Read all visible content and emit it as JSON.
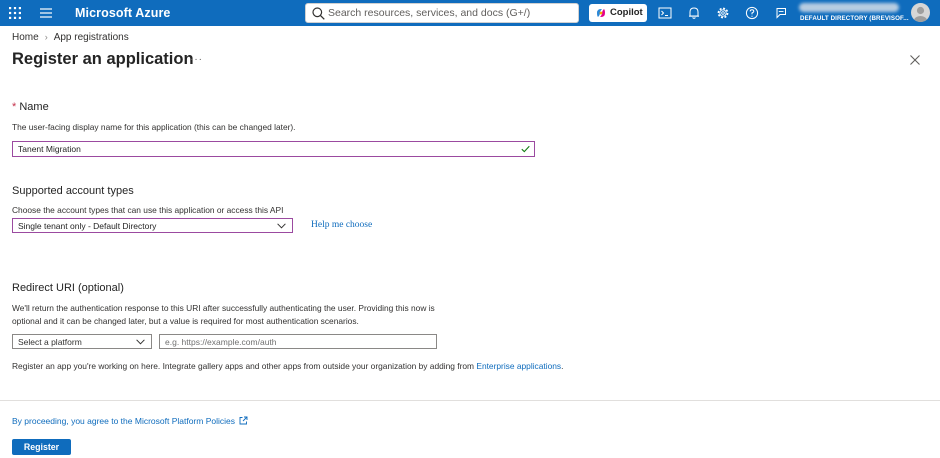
{
  "topbar": {
    "brand": "Microsoft Azure",
    "search_placeholder": "Search resources, services, and docs (G+/)",
    "copilot_label": "Copilot",
    "directory": "DEFAULT DIRECTORY (BREVISOF...",
    "icons": [
      "waffle-icon",
      "hamburger-icon",
      "cloud-shell-icon",
      "notifications-icon",
      "settings-icon",
      "help-icon",
      "feedback-icon"
    ]
  },
  "breadcrumb": {
    "home": "Home",
    "current": "App registrations"
  },
  "page": {
    "title": "Register an application",
    "more": "···"
  },
  "name_section": {
    "required_mark": "*",
    "label": "Name",
    "description": "The user-facing display name for this application (this can be changed later).",
    "value": "Tanent Migration"
  },
  "account_types": {
    "label": "Supported account types",
    "description": "Choose the account types that can use this application or access this API",
    "selected": "Single tenant only - Default Directory",
    "help_link": "Help me choose"
  },
  "redirect": {
    "label": "Redirect URI (optional)",
    "description_line1": "We'll return the authentication response to this URI after successfully authenticating the user. Providing this now is",
    "description_line2": "optional and it can be changed later, but a value is required for most authentication scenarios.",
    "platform_placeholder": "Select a platform",
    "uri_placeholder": "e.g. https://example.com/auth"
  },
  "gallery_note": {
    "text": "Register an app you're working on here. Integrate gallery apps and other apps from outside your organization by adding from ",
    "link": "Enterprise applications",
    "suffix": "."
  },
  "footer": {
    "policy_text": "By proceeding, you agree to the Microsoft Platform Policies",
    "register_label": "Register"
  },
  "colors": {
    "brand_blue": "#0f6cbd",
    "focus_border": "#9b4aa0",
    "required_red": "#c4314b"
  }
}
